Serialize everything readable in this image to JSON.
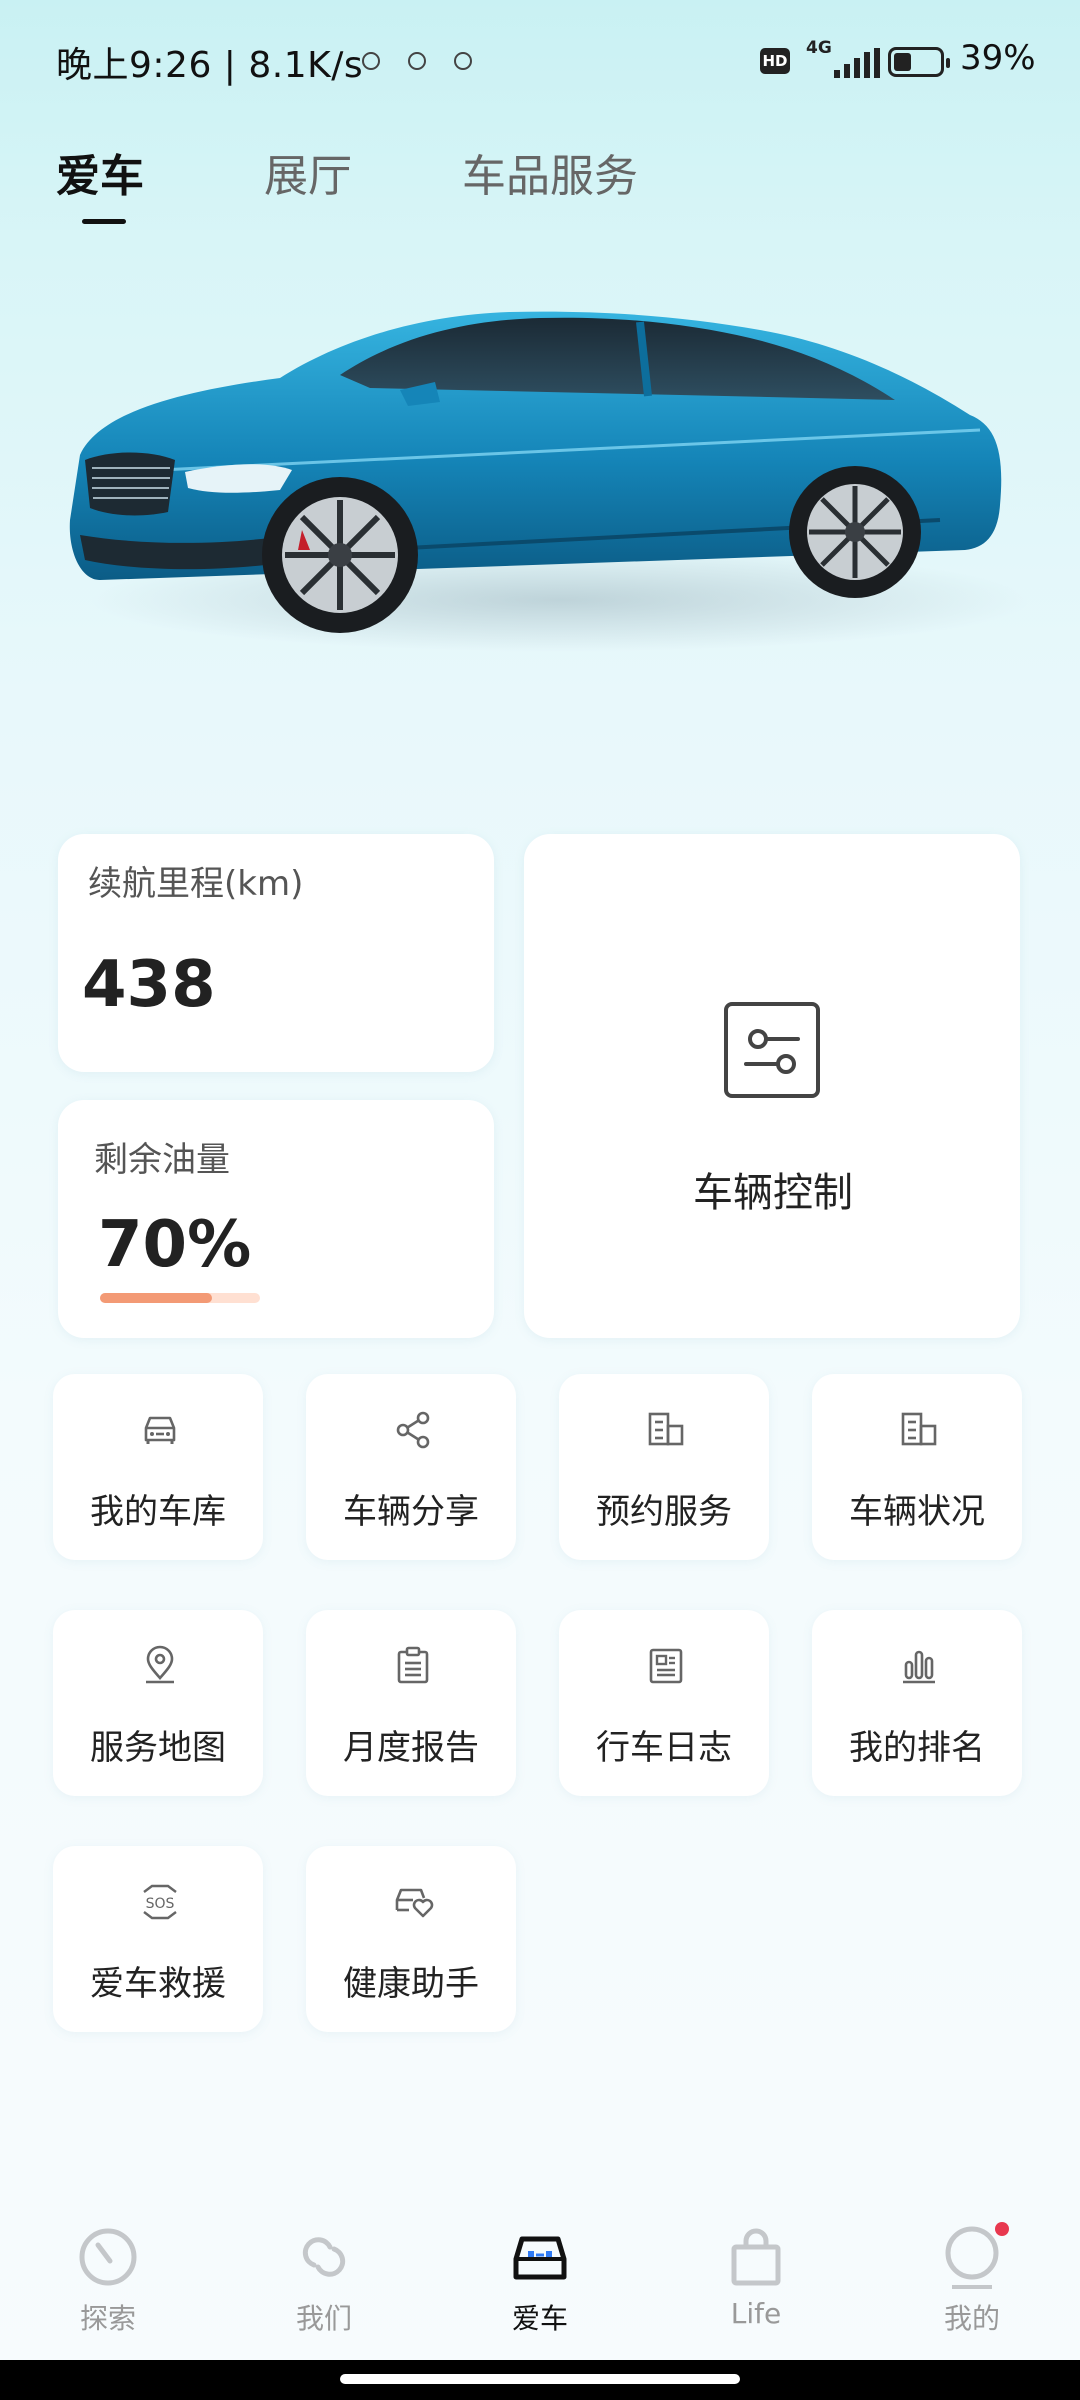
{
  "status_bar": {
    "time_speed": "晚上9:26 | 8.1K/s",
    "hd": "HD",
    "network": "4G",
    "battery_percent": "39%",
    "battery_level": 0.39
  },
  "top_tabs": [
    {
      "label": "爱车",
      "active": true
    },
    {
      "label": "展厅",
      "active": false
    },
    {
      "label": "车品服务",
      "active": false
    }
  ],
  "hero": {
    "car_image": "blue-sedan"
  },
  "range_card": {
    "title": "续航里程(km)",
    "value": "438"
  },
  "fuel_card": {
    "title": "剩余油量",
    "value": "70%",
    "level": 0.7,
    "bar_color": "#f39a75"
  },
  "control_card": {
    "label": "车辆控制",
    "icon": "sliders-icon"
  },
  "services": [
    {
      "label": "我的车库",
      "icon": "car-icon"
    },
    {
      "label": "车辆分享",
      "icon": "share-icon"
    },
    {
      "label": "预约服务",
      "icon": "building-icon"
    },
    {
      "label": "车辆状况",
      "icon": "building-icon"
    },
    {
      "label": "服务地图",
      "icon": "map-pin-icon"
    },
    {
      "label": "月度报告",
      "icon": "clipboard-icon"
    },
    {
      "label": "行车日志",
      "icon": "document-icon"
    },
    {
      "label": "我的排名",
      "icon": "bar-chart-icon"
    },
    {
      "label": "爱车救援",
      "icon": "sos-icon"
    },
    {
      "label": "健康助手",
      "icon": "car-heart-icon"
    }
  ],
  "bottom_nav": [
    {
      "label": "探索",
      "icon": "compass-icon",
      "active": false
    },
    {
      "label": "我们",
      "icon": "link-icon",
      "active": false
    },
    {
      "label": "爱车",
      "icon": "car-front-icon",
      "active": true
    },
    {
      "label": "Life",
      "icon": "shopping-bag-icon",
      "active": false
    },
    {
      "label": "我的",
      "icon": "profile-icon",
      "active": false,
      "badge": true
    }
  ],
  "colors": {
    "accent_red": "#e8384f",
    "fuel_bar": "#f39a75",
    "nav_active_blue": "#2f7bf5"
  }
}
